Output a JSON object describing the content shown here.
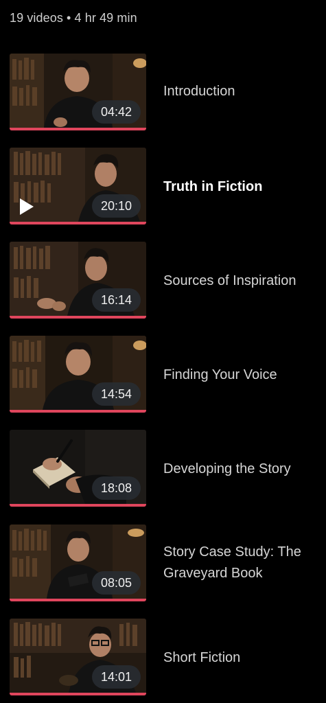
{
  "course": {
    "summary": "19 videos • 4 hr 49 min"
  },
  "lessons": [
    {
      "title": "Introduction",
      "duration": "04:42",
      "progress": 1.0,
      "active": false,
      "thumbnail": "author-portrait"
    },
    {
      "title": "Truth in Fiction",
      "duration": "20:10",
      "progress": 1.0,
      "active": true,
      "thumbnail": "author-profile",
      "playing_icon": "play-icon"
    },
    {
      "title": "Sources of Inspiration",
      "duration": "16:14",
      "progress": 1.0,
      "active": false,
      "thumbnail": "author-gesturing"
    },
    {
      "title": "Finding Your Voice",
      "duration": "14:54",
      "progress": 1.0,
      "active": false,
      "thumbnail": "author-portrait"
    },
    {
      "title": "Developing the Story",
      "duration": "18:08",
      "progress": 1.0,
      "active": false,
      "thumbnail": "hand-writing-notebook"
    },
    {
      "title": "Story Case Study: The Graveyard Book",
      "duration": "08:05",
      "progress": 1.0,
      "active": false,
      "thumbnail": "author-with-book"
    },
    {
      "title": "Short Fiction",
      "duration": "14:01",
      "progress": 1.0,
      "active": false,
      "thumbnail": "author-reading-glasses"
    }
  ],
  "colors": {
    "background": "#000000",
    "progress": "#e0465d",
    "duration_pill": "#282c32"
  }
}
